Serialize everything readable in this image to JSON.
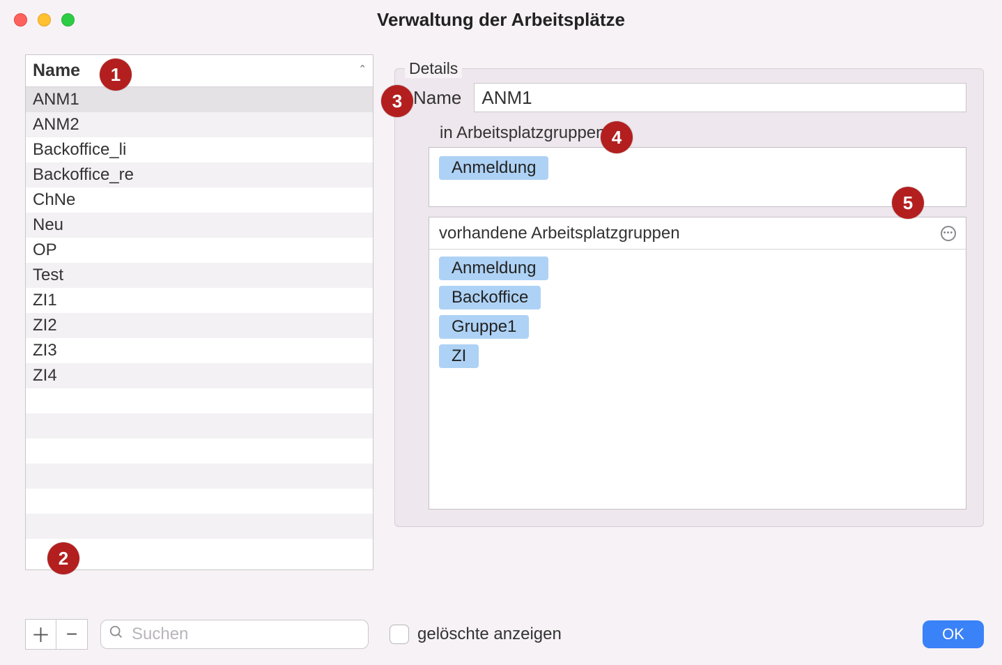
{
  "window": {
    "title": "Verwaltung der Arbeitsplätze"
  },
  "list": {
    "column_header": "Name",
    "sort": "asc",
    "items": [
      "ANM1",
      "ANM2",
      "Backoffice_li",
      "Backoffice_re",
      "ChNe",
      "Neu",
      "OP",
      "Test",
      "ZI1",
      "ZI2",
      "ZI3",
      "ZI4"
    ],
    "selected_index": 0
  },
  "details": {
    "legend": "Details",
    "name_label": "Name",
    "name_value": "ANM1",
    "assigned_label": "in Arbeitsplatzgruppen",
    "assigned_groups": [
      "Anmeldung"
    ],
    "available_label": "vorhandene Arbeitsplatzgruppen",
    "available_groups": [
      "Anmeldung",
      "Backoffice",
      "Gruppe1",
      "ZI"
    ]
  },
  "toolbar": {
    "add_glyph": "＋",
    "remove_glyph": "−",
    "search_placeholder": "Suchen",
    "show_deleted_label": "gelöschte anzeigen",
    "ok_label": "OK"
  },
  "annotations": [
    "1",
    "2",
    "3",
    "4",
    "5"
  ]
}
